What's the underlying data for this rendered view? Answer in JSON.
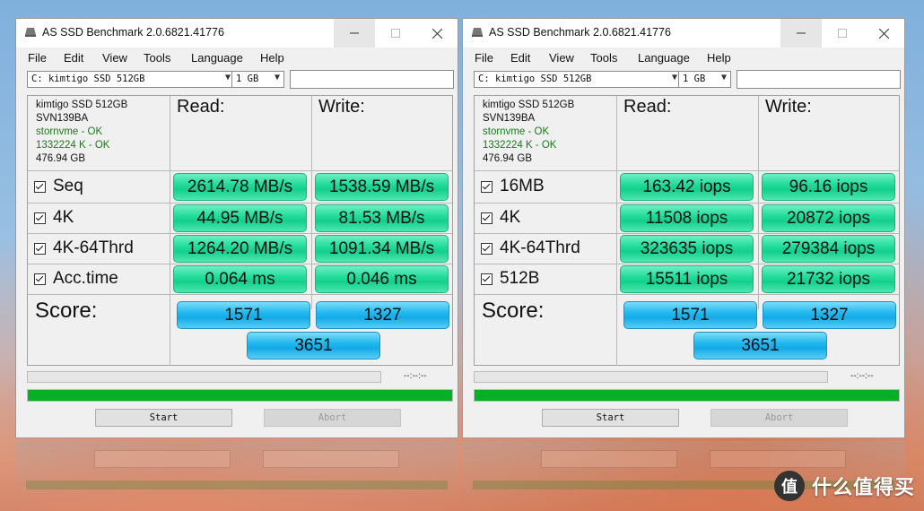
{
  "windows": [
    {
      "title": "AS SSD Benchmark 2.0.6821.41776",
      "menu": [
        "File",
        "Edit",
        "View",
        "Tools",
        "Language",
        "Help"
      ],
      "drive_select": "C: kimtigo SSD 512GB",
      "size_select": "1 GB",
      "info": {
        "model": "kimtigo SSD 512GB",
        "firmware": "SVN139BA",
        "driver": "stornvme - OK",
        "alignment": "1332224 K - OK",
        "capacity": "476.94 GB"
      },
      "headers": {
        "read": "Read:",
        "write": "Write:"
      },
      "rows": [
        {
          "label": "Seq",
          "read": "2614.78 MB/s",
          "write": "1538.59 MB/s"
        },
        {
          "label": "4K",
          "read": "44.95 MB/s",
          "write": "81.53 MB/s"
        },
        {
          "label": "4K-64Thrd",
          "read": "1264.20 MB/s",
          "write": "1091.34 MB/s"
        },
        {
          "label": "Acc.time",
          "read": "0.064 ms",
          "write": "0.046 ms"
        }
      ],
      "score": {
        "label": "Score:",
        "read": "1571",
        "write": "1327",
        "total": "3651"
      },
      "time": "--:--:--",
      "buttons": {
        "start": "Start",
        "abort": "Abort"
      }
    },
    {
      "title": "AS SSD Benchmark 2.0.6821.41776",
      "menu": [
        "File",
        "Edit",
        "View",
        "Tools",
        "Language",
        "Help"
      ],
      "drive_select": "C: kimtigo SSD 512GB",
      "size_select": "1 GB",
      "info": {
        "model": "kimtigo SSD 512GB",
        "firmware": "SVN139BA",
        "driver": "stornvme - OK",
        "alignment": "1332224 K - OK",
        "capacity": "476.94 GB"
      },
      "headers": {
        "read": "Read:",
        "write": "Write:"
      },
      "rows": [
        {
          "label": "16MB",
          "read": "163.42 iops",
          "write": "96.16 iops"
        },
        {
          "label": "4K",
          "read": "11508 iops",
          "write": "20872 iops"
        },
        {
          "label": "4K-64Thrd",
          "read": "323635 iops",
          "write": "279384 iops"
        },
        {
          "label": "512B",
          "read": "15511 iops",
          "write": "21732 iops"
        }
      ],
      "score": {
        "label": "Score:",
        "read": "1571",
        "write": "1327",
        "total": "3651"
      },
      "time": "--:--:--",
      "buttons": {
        "start": "Start",
        "abort": "Abort"
      }
    }
  ],
  "watermark": {
    "logo": "值",
    "text": "什么值得买"
  },
  "colors": {
    "result_green": "#23dc9c",
    "score_blue": "#22b9f0",
    "progress_green": "#06b025"
  }
}
